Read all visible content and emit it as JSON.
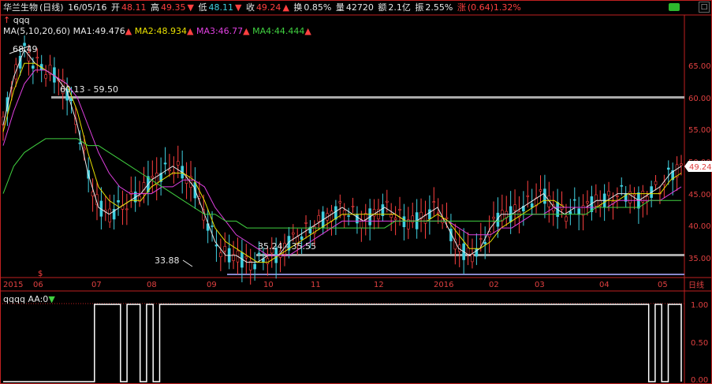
{
  "header": {
    "stock_name": "华兰生物",
    "period": "(日线)",
    "date": "16/05/16",
    "open_label": "开",
    "open_value": "48.11",
    "high_label": "高",
    "high_value": "49.35",
    "low_label": "低",
    "low_value": "48.11",
    "close_label": "收",
    "close_value": "49.24",
    "turnover_label": "换",
    "turnover_value": "0.85%",
    "volume_label": "量",
    "volume_value": "42720",
    "amount_label": "额",
    "amount_value": "2.1亿",
    "amplitude_label": "振",
    "amplitude_value": "2.55%",
    "change_label": "涨",
    "change_value": "(0.64)1.32%",
    "indicator_name": "qqq"
  },
  "ma": {
    "label": "MA(5,10,20,60)",
    "ma1": "MA1:49.476",
    "ma2": "MA2:48.934",
    "ma3": "MA3:46.77",
    "ma4": "MA4:44.444"
  },
  "colors": {
    "ma1": "#e8e8e8",
    "ma2": "#e8e000",
    "ma3": "#e040e0",
    "ma4": "#40d040",
    "up": "#ff4040",
    "down": "#40d0e0",
    "axis": "#c02020"
  },
  "annotations": {
    "high_point": "68.49",
    "low_point": "33.88",
    "upper_band": "60.13 - 59.50",
    "lower_band": "35.24 - 35.55",
    "current_price": "49.24"
  },
  "price_axis": [
    "65.00",
    "60.00",
    "55.00",
    "50.00",
    "45.00",
    "40.00",
    "35.00"
  ],
  "time_axis": [
    "2015",
    "06",
    "07",
    "08",
    "09",
    "10",
    "11",
    "12",
    "2016",
    "02",
    "03",
    "04",
    "05"
  ],
  "period_tag": "日线",
  "indicator": {
    "title": "qqqq",
    "aa_label": "AA:0",
    "axis": [
      "1.00",
      "0.50",
      "0.00"
    ]
  },
  "chart_data": {
    "type": "line",
    "title": "",
    "xlabel": "",
    "ylabel": "",
    "ylim": [
      33,
      70
    ],
    "series": [
      {
        "name": "MA1",
        "values": [
          55,
          62,
          66,
          64,
          63,
          62,
          60,
          55,
          48,
          43,
          42,
          43,
          44,
          45,
          47,
          48,
          49,
          48,
          46,
          42,
          38,
          36,
          36,
          35,
          35,
          36,
          36,
          38,
          39,
          40,
          41,
          42,
          43,
          42,
          41,
          42,
          43,
          42,
          41,
          41,
          42,
          43,
          40,
          37,
          36,
          37,
          40,
          42,
          42,
          43,
          44,
          45,
          43,
          42,
          43,
          43,
          44,
          44,
          45,
          45,
          44,
          45,
          46,
          48,
          49
        ]
      },
      {
        "name": "MA2",
        "values": [
          54,
          60,
          64,
          64,
          63,
          62,
          61,
          57,
          51,
          46,
          44,
          43,
          44,
          44,
          46,
          47,
          48,
          48,
          47,
          44,
          40,
          38,
          37,
          36,
          35,
          35,
          36,
          37,
          38,
          39,
          40,
          41,
          42,
          42,
          42,
          42,
          42,
          42,
          41,
          41,
          41,
          42,
          41,
          39,
          37,
          37,
          38,
          40,
          41,
          42,
          43,
          44,
          44,
          43,
          43,
          43,
          43,
          44,
          44,
          45,
          45,
          45,
          45,
          47,
          48
        ]
      },
      {
        "name": "MA3",
        "values": [
          52,
          57,
          61,
          63,
          63,
          62,
          61,
          59,
          55,
          51,
          48,
          46,
          45,
          45,
          45,
          46,
          46,
          47,
          47,
          46,
          43,
          41,
          39,
          38,
          37,
          36,
          36,
          36,
          37,
          38,
          39,
          40,
          41,
          41,
          41,
          41,
          41,
          41,
          41,
          41,
          41,
          41,
          41,
          40,
          39,
          39,
          39,
          40,
          40,
          41,
          42,
          42,
          43,
          43,
          43,
          43,
          43,
          43,
          44,
          44,
          44,
          44,
          44,
          45,
          46
        ]
      },
      {
        "name": "MA4",
        "values": [
          45,
          49,
          51,
          52,
          53,
          53,
          53,
          53,
          52,
          52,
          51,
          50,
          49,
          48,
          47,
          46,
          45,
          44,
          43,
          42,
          42,
          41,
          41,
          40,
          40,
          40,
          40,
          40,
          40,
          40,
          40,
          40,
          40,
          40,
          40,
          40,
          40,
          41,
          41,
          41,
          41,
          41,
          41,
          41,
          41,
          41,
          41,
          41,
          42,
          42,
          42,
          42,
          42,
          42,
          42,
          42,
          43,
          43,
          43,
          43,
          43,
          44,
          44,
          44,
          44
        ]
      }
    ],
    "signal_series": {
      "name": "AA",
      "values": [
        0,
        0,
        0,
        0,
        0,
        0,
        0,
        0,
        0,
        0,
        0,
        0,
        0,
        0,
        1,
        1,
        1,
        1,
        0,
        1,
        1,
        0,
        1,
        0,
        1,
        1,
        1,
        1,
        1,
        1,
        1,
        1,
        1,
        1,
        1,
        1,
        1,
        1,
        1,
        1,
        1,
        1,
        1,
        1,
        1,
        1,
        1,
        1,
        1,
        1,
        1,
        1,
        1,
        1,
        1,
        1,
        1,
        1,
        1,
        1,
        1,
        1,
        1,
        1,
        1,
        1,
        1,
        1,
        1,
        1,
        1,
        1,
        1,
        1,
        1,
        1,
        1,
        1,
        1,
        1,
        1,
        1,
        1,
        1,
        1,
        1,
        1,
        1,
        1,
        1,
        1,
        1,
        1,
        1,
        1,
        1,
        1,
        1,
        1,
        0,
        1,
        0,
        1,
        1,
        0
      ]
    }
  }
}
